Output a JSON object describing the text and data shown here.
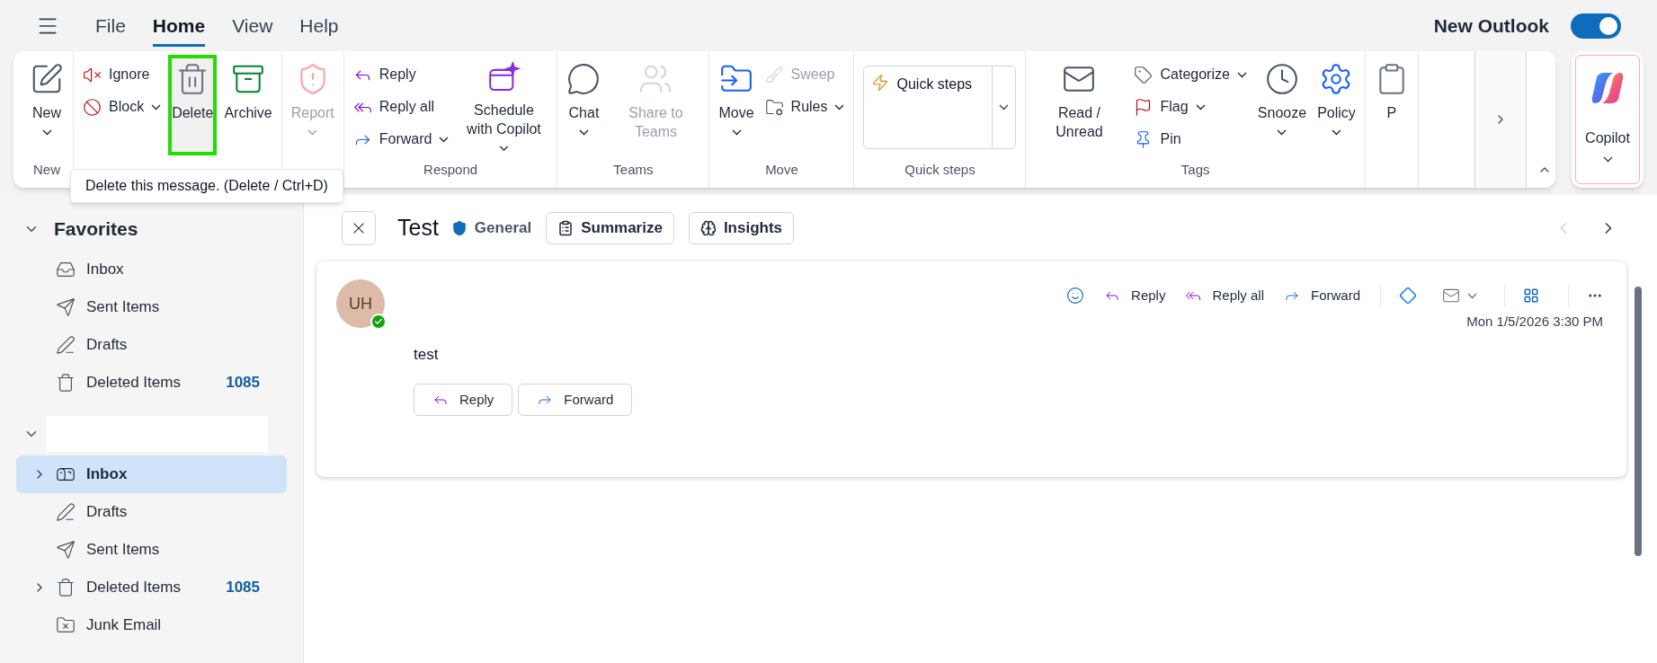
{
  "menu_tabs": [
    {
      "label": "File",
      "selected": false
    },
    {
      "label": "Home",
      "selected": true
    },
    {
      "label": "View",
      "selected": false
    },
    {
      "label": "Help",
      "selected": false
    }
  ],
  "new_outlook": {
    "label": "New Outlook",
    "on": true
  },
  "ribbon": {
    "groups": [
      {
        "label": "New",
        "items": [
          {
            "kind": "large",
            "label": "New",
            "dropdown": true,
            "disabled": false,
            "highlighted": false
          }
        ]
      },
      {
        "items": [
          {
            "kind": "small",
            "label": "Ignore",
            "dropdown": false,
            "disabled": false,
            "highlighted": false
          },
          {
            "kind": "small",
            "label": "Block",
            "dropdown": true,
            "disabled": false,
            "highlighted": false
          },
          {
            "kind": "large",
            "label": "Delete",
            "dropdown": false,
            "disabled": false,
            "highlighted": true
          },
          {
            "kind": "large",
            "label": "Archive",
            "dropdown": false,
            "disabled": false,
            "highlighted": false
          }
        ]
      },
      {
        "items": [
          {
            "kind": "large",
            "label": "Report",
            "dropdown": true,
            "disabled": true,
            "highlighted": false
          }
        ]
      },
      {
        "label": "Respond",
        "items": [
          {
            "kind": "small",
            "label": "Reply",
            "dropdown": false,
            "disabled": false,
            "highlighted": false
          },
          {
            "kind": "small",
            "label": "Reply all",
            "dropdown": false,
            "disabled": false,
            "highlighted": false
          },
          {
            "kind": "small",
            "label": "Forward",
            "dropdown": true,
            "disabled": false,
            "highlighted": false
          },
          {
            "kind": "large",
            "label": "Schedule with Copilot",
            "dropdown": true,
            "disabled": false,
            "highlighted": false
          }
        ]
      },
      {
        "label": "Teams",
        "items": [
          {
            "kind": "large",
            "label": "Chat",
            "dropdown": true,
            "disabled": false,
            "highlighted": false
          },
          {
            "kind": "large",
            "label": "Share to Teams",
            "dropdown": false,
            "disabled": true,
            "highlighted": false
          }
        ]
      },
      {
        "label": "Move",
        "items": [
          {
            "kind": "large",
            "label": "Move",
            "dropdown": true,
            "disabled": false,
            "highlighted": false
          },
          {
            "kind": "small",
            "label": "Sweep",
            "dropdown": false,
            "disabled": true,
            "highlighted": false
          },
          {
            "kind": "small",
            "label": "Rules",
            "dropdown": true,
            "disabled": false,
            "highlighted": false
          }
        ]
      },
      {
        "label": "Quick steps",
        "items": [
          {
            "kind": "gallery",
            "label": "Quick steps",
            "dropdown": true,
            "disabled": false,
            "highlighted": false
          }
        ]
      },
      {
        "label": "Tags",
        "items": [
          {
            "kind": "large",
            "label": "Read / Unread",
            "dropdown": false,
            "disabled": false,
            "highlighted": false
          },
          {
            "kind": "small",
            "label": "Categorize",
            "dropdown": true,
            "disabled": false,
            "highlighted": false
          },
          {
            "kind": "small",
            "label": "Flag",
            "dropdown": true,
            "disabled": false,
            "highlighted": false
          },
          {
            "kind": "small",
            "label": "Pin",
            "dropdown": false,
            "disabled": false,
            "highlighted": false
          },
          {
            "kind": "large",
            "label": "Snooze",
            "dropdown": true,
            "disabled": false,
            "highlighted": false
          },
          {
            "kind": "large",
            "label": "Policy",
            "dropdown": true,
            "disabled": false,
            "highlighted": false
          }
        ]
      },
      {
        "items": [
          {
            "kind": "large",
            "label": "P",
            "dropdown": false,
            "disabled": false,
            "highlighted": false
          }
        ]
      }
    ]
  },
  "copilot": {
    "label": "Copilot"
  },
  "tooltip": "Delete this message. (Delete / Ctrl+D)",
  "sidebar": {
    "sections": [
      {
        "label": "Favorites",
        "expanded": true,
        "items": [
          {
            "label": "Inbox",
            "selected": false,
            "expandable": false
          },
          {
            "label": "Sent Items",
            "selected": false,
            "expandable": false
          },
          {
            "label": "Drafts",
            "selected": false,
            "expandable": false
          },
          {
            "label": "Deleted Items",
            "count": "1085",
            "selected": false,
            "expandable": false
          }
        ]
      },
      {
        "redacted": true,
        "expanded": true,
        "items": [
          {
            "label": "Inbox",
            "selected": true,
            "expandable": true
          },
          {
            "label": "Drafts",
            "selected": false,
            "expandable": false
          },
          {
            "label": "Sent Items",
            "selected": false,
            "expandable": false
          },
          {
            "label": "Deleted Items",
            "count": "1085",
            "selected": false,
            "expandable": true
          },
          {
            "label": "Junk Email",
            "selected": false,
            "expandable": false
          }
        ]
      }
    ]
  },
  "reading_pane": {
    "subject": "Test",
    "sensitivity": "General",
    "tools": [
      "Summarize",
      "Insights"
    ],
    "message": {
      "initials": "UH",
      "online": true,
      "actions": [
        "Reply",
        "Reply all",
        "Forward"
      ],
      "date": "Mon 1/5/2026 3:30 PM",
      "body": "test",
      "footer_actions": [
        "Reply",
        "Forward"
      ]
    }
  }
}
